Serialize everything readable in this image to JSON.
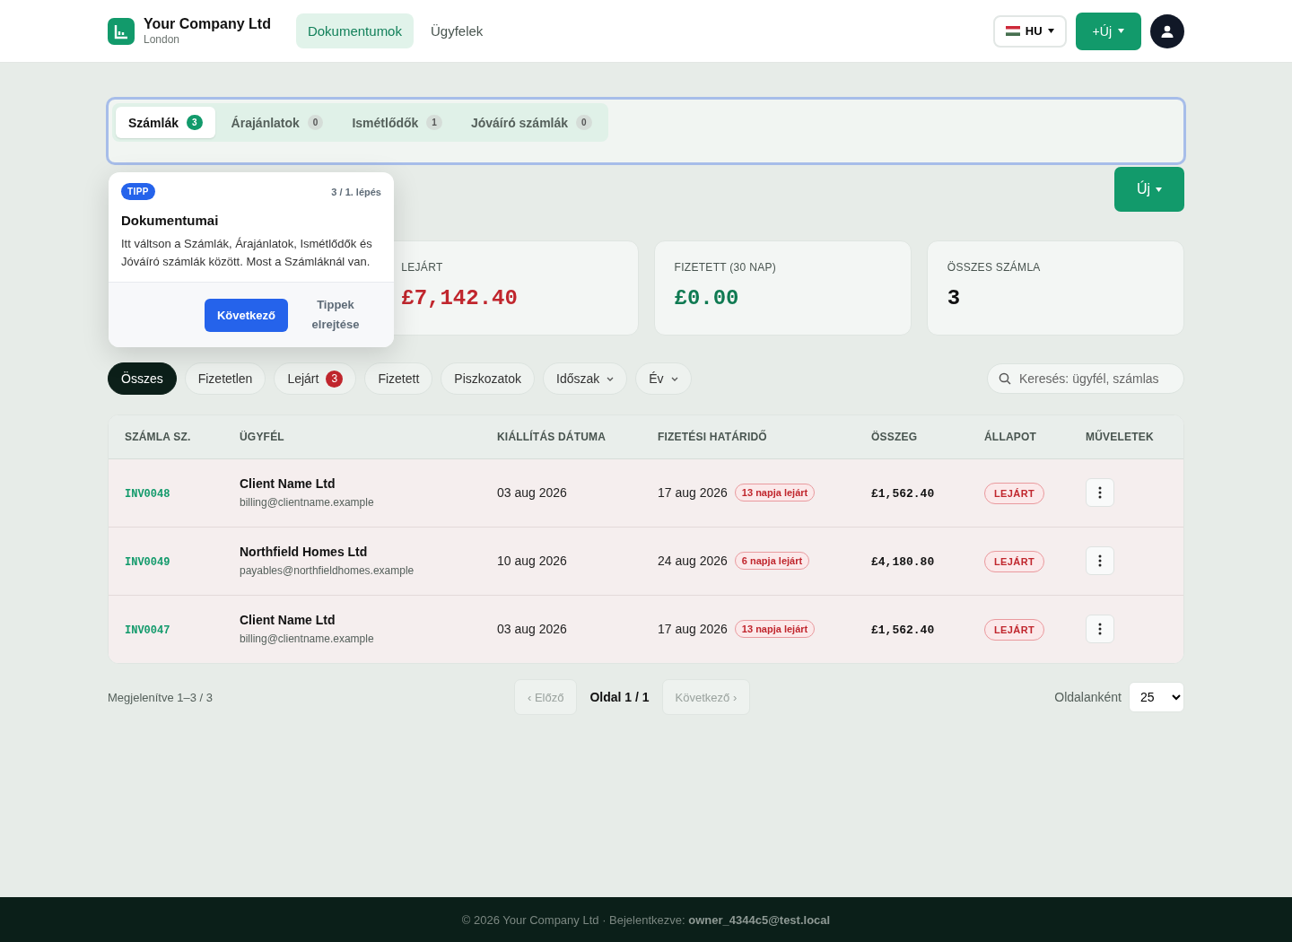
{
  "header": {
    "brand": {
      "name": "Your Company Ltd",
      "city": "London"
    },
    "nav": [
      {
        "label": "Dokumentumok",
        "selected": true
      },
      {
        "label": "Ügyfelek",
        "selected": false
      }
    ],
    "language": "HU",
    "new_button": "+Új"
  },
  "doc_tabs": [
    {
      "label": "Számlák",
      "count": "3",
      "selected": true
    },
    {
      "label": "Árajánlatok",
      "count": "0",
      "selected": false
    },
    {
      "label": "Ismétlődők",
      "count": "1",
      "selected": false
    },
    {
      "label": "Jóváíró számlák",
      "count": "0",
      "selected": false
    }
  ],
  "page_new_button": "Új",
  "tip": {
    "badge": "TIPP",
    "step": "3 / 1. lépés",
    "title": "Dokumentumai",
    "text": "Itt váltson a Számlák, Árajánlatok, Ismétlődők és Jóváíró számlák között. Most a Számláknál van.",
    "next": "Következő",
    "hide": "Tippek elrejtése"
  },
  "stats": [
    {
      "label": "LEJÁRT",
      "value": "£7,142.40",
      "kind": "danger"
    },
    {
      "label": "FIZETETT (30 NAP)",
      "value": "£0.00",
      "kind": "success"
    },
    {
      "label": "ÖSSZES SZÁMLA",
      "value": "3",
      "kind": "neutral"
    }
  ],
  "filters": [
    {
      "label": "Összes",
      "kind": "chip",
      "selected": true
    },
    {
      "label": "Fizetetlen",
      "kind": "chip",
      "selected": false
    },
    {
      "label": "Lejárt",
      "kind": "chip",
      "selected": false,
      "count": "3"
    },
    {
      "label": "Fizetett",
      "kind": "chip",
      "selected": false
    },
    {
      "label": "Piszkozatok",
      "kind": "chip",
      "selected": false
    },
    {
      "label": "Időszak",
      "kind": "dropdown",
      "selected": false
    },
    {
      "label": "Év",
      "kind": "dropdown",
      "selected": false
    }
  ],
  "search": {
    "placeholder": "Keresés: ügyfél, számlas"
  },
  "table": {
    "columns": [
      "SZÁMLA SZ.",
      "ÜGYFÉL",
      "KIÁLLÍTÁS DÁTUMA",
      "FIZETÉSI HATÁRIDŐ",
      "ÖSSZEG",
      "ÁLLAPOT",
      "MŰVELETEK"
    ],
    "rows": [
      {
        "number": "INV0048",
        "client": "Client Name Ltd",
        "email": "billing@clientname.example",
        "issued": "03 aug 2026",
        "due": "17 aug 2026",
        "overdue": "13 napja lejárt",
        "amount": "£1,562.40",
        "status": "LEJÁRT"
      },
      {
        "number": "INV0049",
        "client": "Northfield Homes Ltd",
        "email": "payables@northfieldhomes.example",
        "issued": "10 aug 2026",
        "due": "24 aug 2026",
        "overdue": "6 napja lejárt",
        "amount": "£4,180.80",
        "status": "LEJÁRT"
      },
      {
        "number": "INV0047",
        "client": "Client Name Ltd",
        "email": "billing@clientname.example",
        "issued": "03 aug 2026",
        "due": "17 aug 2026",
        "overdue": "13 napja lejárt",
        "amount": "£1,562.40",
        "status": "LEJÁRT"
      }
    ]
  },
  "pagination": {
    "summary": "Megjelenítve 1–3 / 3",
    "prev": "‹ Előző",
    "prev_disabled": true,
    "page": "Oldal 1 / 1",
    "next": "Következő ›",
    "next_disabled": true,
    "per_page_label": "Oldalanként",
    "per_page": "25"
  },
  "footer": "© 2026 Your Company Ltd · Bejelentkezve: **owner_4344c5@test.local**"
}
